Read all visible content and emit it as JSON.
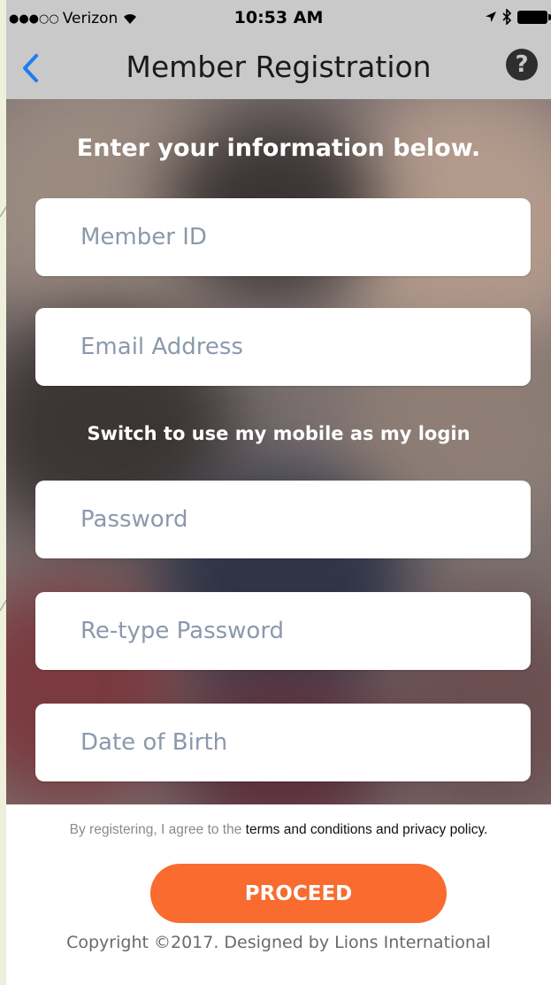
{
  "status_bar": {
    "signal_dots": "●●●○○",
    "carrier": "Verizon",
    "time": "10:53 AM",
    "icons": [
      "wifi-icon",
      "location-arrow-icon",
      "bluetooth-icon",
      "battery-icon"
    ]
  },
  "nav": {
    "title": "Member Registration",
    "back_icon": "chevron-left-icon",
    "help_icon": "question-circle-icon",
    "help_label": "?"
  },
  "form": {
    "heading": "Enter your information below.",
    "member_id_placeholder": "Member ID",
    "email_placeholder": "Email Address",
    "switch_label": "Switch to use my mobile as my login",
    "password_placeholder": "Password",
    "retype_password_placeholder": "Re-type Password",
    "dob_placeholder": "Date of Birth"
  },
  "footer": {
    "terms_prefix": "By registering, I agree to the",
    "terms_link": "terms and conditions and privacy policy.",
    "proceed_label": "PROCEED",
    "copyright": "Copyright ©2017. Designed by Lions International"
  },
  "colors": {
    "nav_background": "#c9c9c9",
    "accent_blue": "#1e7cf2",
    "proceed_orange": "#f96b2f",
    "placeholder": "#8b99ad"
  }
}
